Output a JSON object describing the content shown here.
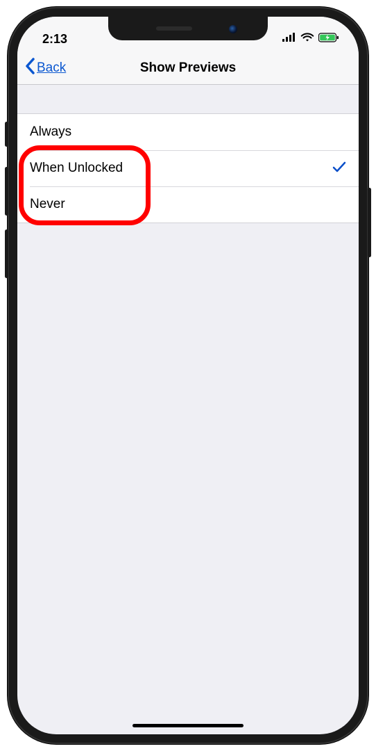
{
  "status": {
    "time": "2:13"
  },
  "nav": {
    "back_label": "Back",
    "title": "Show Previews"
  },
  "options": [
    {
      "label": "Always",
      "selected": false
    },
    {
      "label": "When Unlocked",
      "selected": true
    },
    {
      "label": "Never",
      "selected": false
    }
  ],
  "annotation": {
    "highlights_options": [
      1,
      2
    ]
  }
}
